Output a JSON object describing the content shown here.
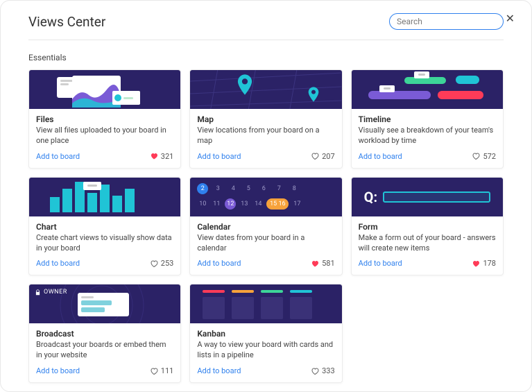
{
  "header": {
    "title": "Views Center"
  },
  "search": {
    "placeholder": "Search"
  },
  "section": {
    "label": "Essentials"
  },
  "actions": {
    "add_to_board": "Add to board",
    "owner_badge": "OWNER"
  },
  "cards": {
    "files": {
      "title": "Files",
      "desc": "View all files uploaded to your board in one place",
      "likes": 321,
      "liked": true
    },
    "map": {
      "title": "Map",
      "desc": "View locations from your board on a map",
      "likes": 207,
      "liked": false
    },
    "timeline": {
      "title": "Timeline",
      "desc": "Visually see a breakdown of your team's workload by time",
      "likes": 572,
      "liked": false
    },
    "chart": {
      "title": "Chart",
      "desc": "Create chart views to visually show data in your board",
      "likes": 253,
      "liked": false
    },
    "calendar": {
      "title": "Calendar",
      "desc": "View dates from your board in a calendar",
      "likes": 581,
      "liked": true
    },
    "form": {
      "title": "Form",
      "desc": "Make a form out of your board - answers will create new items",
      "likes": 178,
      "liked": true
    },
    "broadcast": {
      "title": "Broadcast",
      "desc": "Broadcast your boards or embed them in your website",
      "likes": 111,
      "liked": false
    },
    "kanban": {
      "title": "Kanban",
      "desc": "A way to view your board with cards and lists in a pipeline",
      "likes": 333,
      "liked": false
    }
  },
  "calendar_thumb": {
    "row1": [
      "2",
      "3",
      "4",
      "5",
      "6",
      "7",
      "8"
    ],
    "row2": [
      "10",
      "11",
      "12",
      "13",
      "14",
      "15",
      "16",
      "17"
    ]
  },
  "icons": {
    "form_q": "Q:"
  }
}
